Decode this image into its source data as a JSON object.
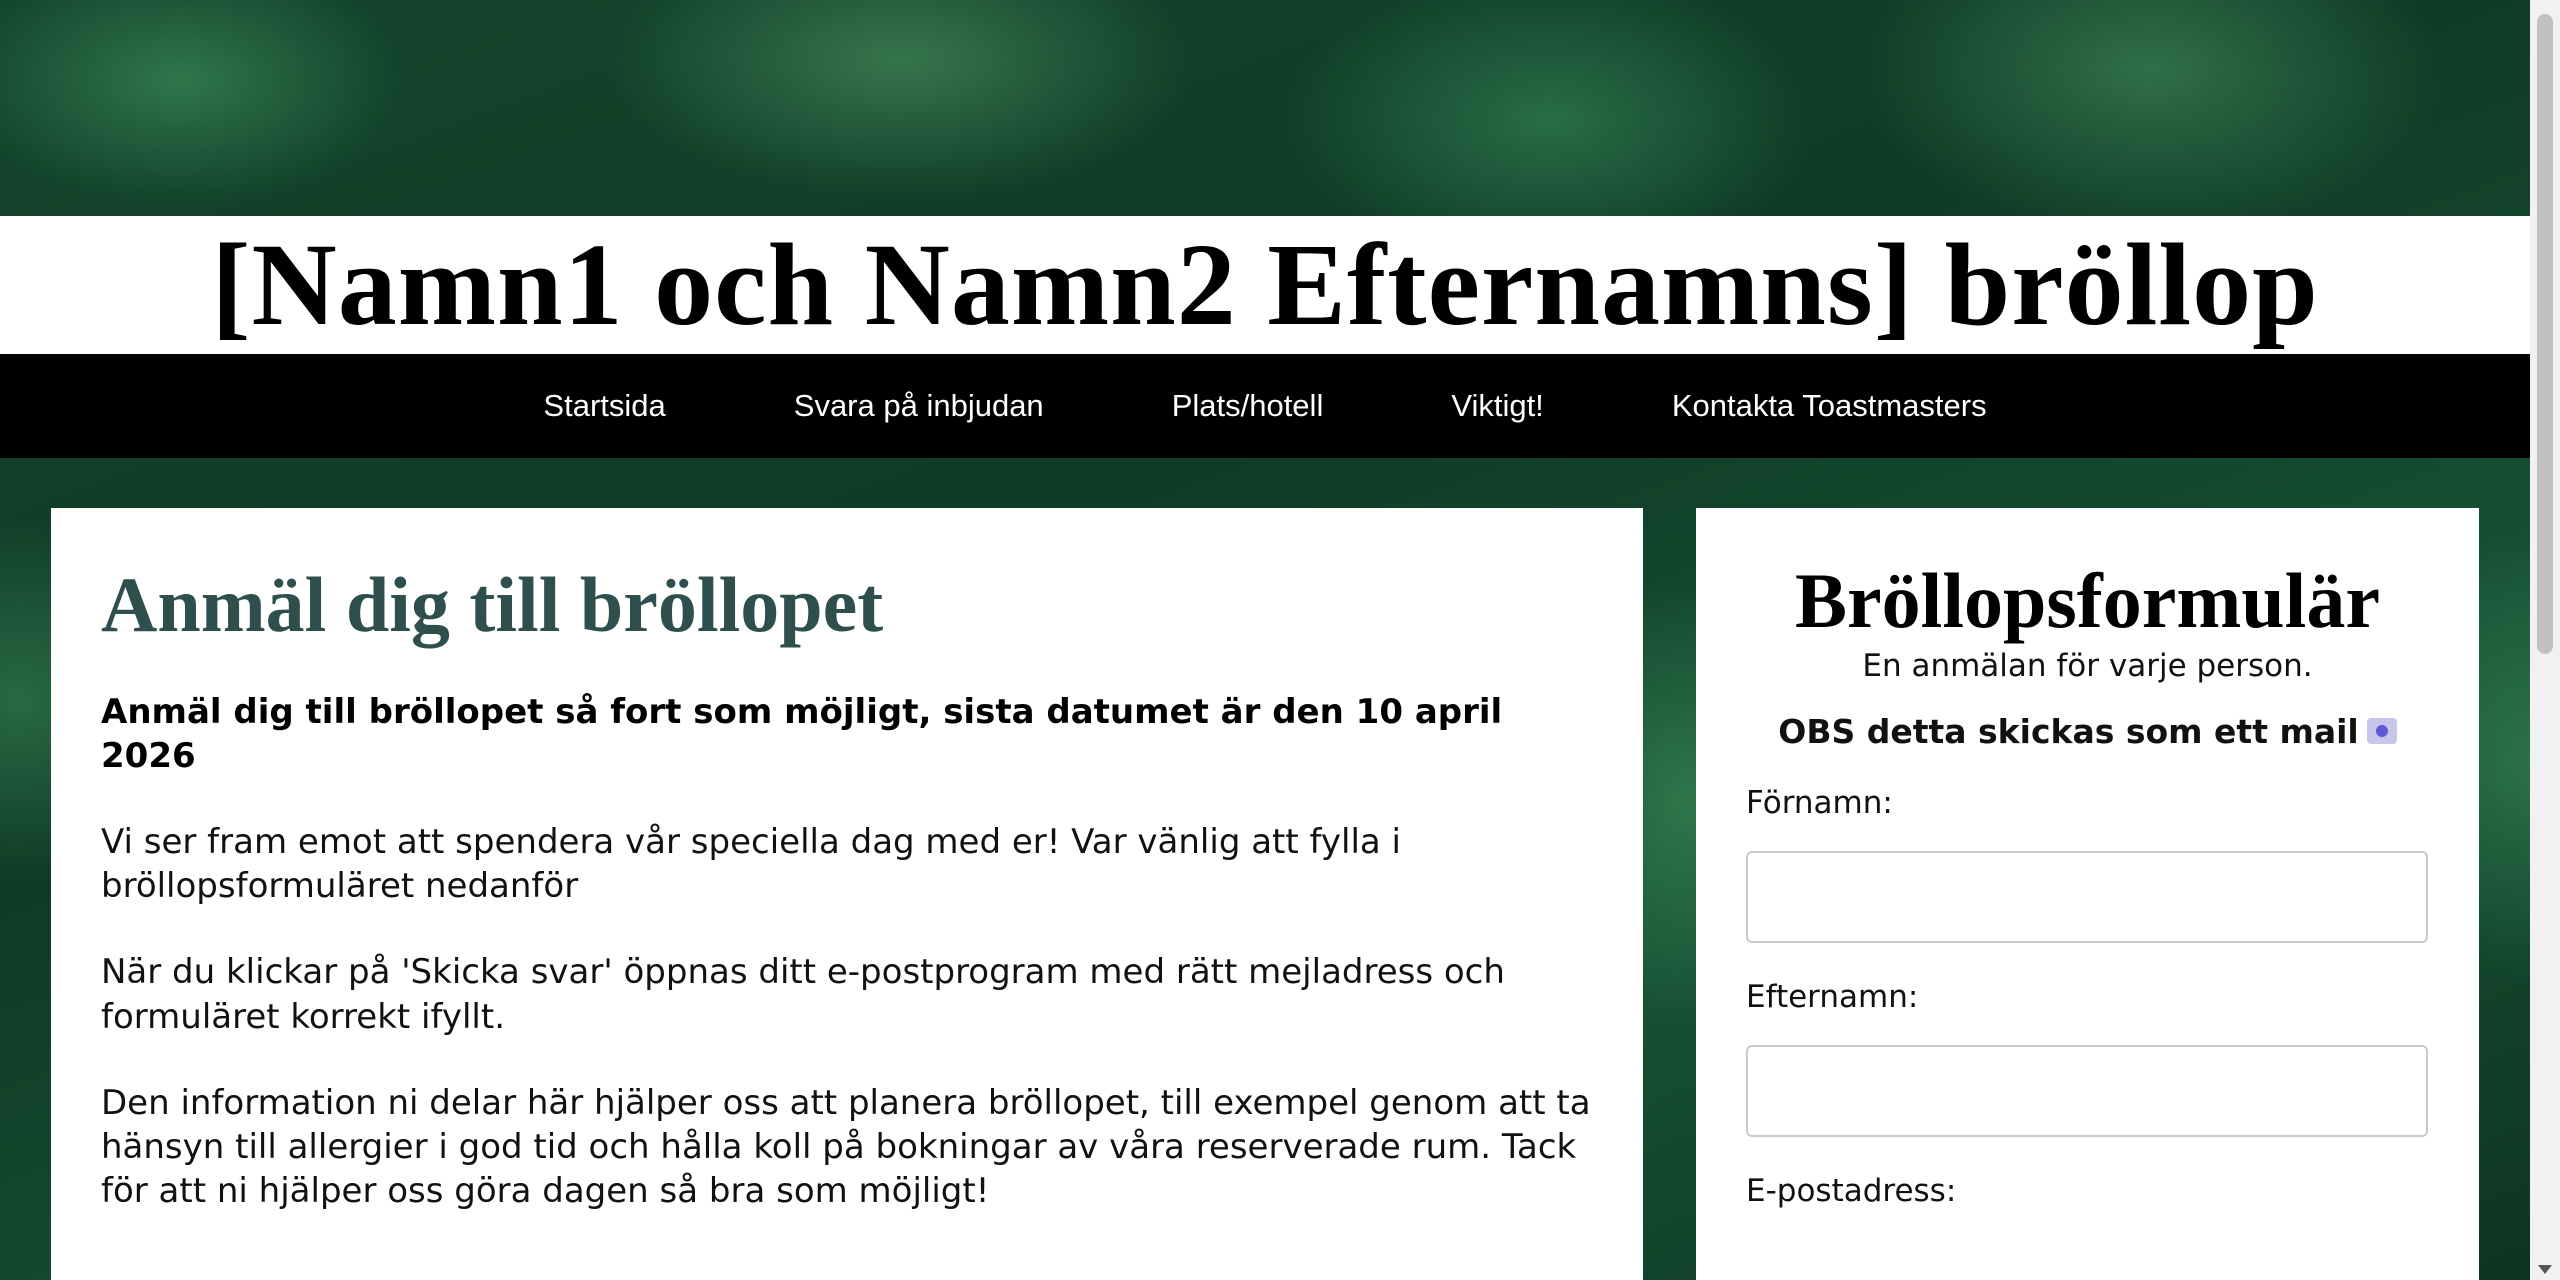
{
  "site_title": "[Namn1 och Namn2 Efternamns] bröllop",
  "nav": {
    "items": [
      "Startsida",
      "Svara på inbjudan",
      "Plats/hotell",
      "Viktigt!",
      "Kontakta Toastmasters"
    ]
  },
  "main": {
    "heading": "Anmäl dig till bröllopet",
    "lead": "Anmäl dig till bröllopet så fort som möjligt, sista datumet är den 10 april 2026",
    "paragraphs": [
      "Vi ser fram emot att spendera vår speciella dag med er! Var vänlig att fylla i bröllopsformuläret nedanför",
      "När du klickar på 'Skicka svar' öppnas ditt e-postprogram med rätt mejladress och formuläret korrekt ifyllt.",
      "Den information ni delar här hjälper oss att planera bröllopet, till exempel genom att ta hänsyn till allergier i god tid och hålla koll på bokningar av våra reserverade rum. Tack för att ni hjälper oss göra dagen så bra som möjligt!"
    ]
  },
  "form": {
    "title": "Bröllopsformulär",
    "subtitle": "En anmälan för varje person.",
    "note": "OBS detta skickas som ett mail",
    "note_icon": "email-emoji-icon",
    "fields": [
      {
        "label": "Förnamn:",
        "value": ""
      },
      {
        "label": "Efternamn:",
        "value": ""
      },
      {
        "label": "E-postadress:",
        "value": ""
      }
    ]
  },
  "colors": {
    "heading_accent": "#2f4f4f",
    "nav_bg": "#000000",
    "leaf_green": "#175234"
  }
}
